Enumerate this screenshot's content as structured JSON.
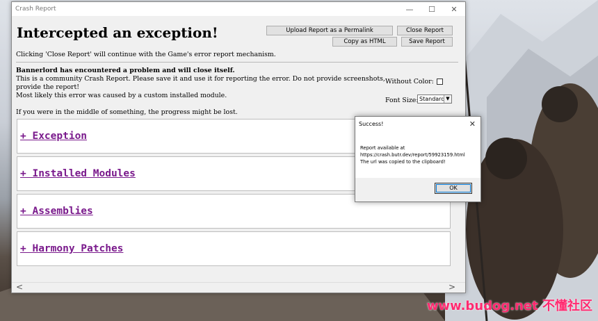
{
  "window": {
    "title": "Crash Report",
    "controls": {
      "minimize": "—",
      "maximize": "☐",
      "close": "✕"
    }
  },
  "header": {
    "heading": "Intercepted an exception!",
    "buttons": {
      "upload": "Upload Report as a Permalink",
      "close_report": "Close Report",
      "copy_html": "Copy as HTML",
      "save_report": "Save Report"
    },
    "note": "Clicking 'Close Report' will continue with the Game's error report mechanism."
  },
  "info": {
    "bold_line": "Bannerlord has encountered a problem and will close itself.",
    "line2": "This is a community Crash Report. Please save it and use it for reporting the error. Do not provide screenshots,",
    "line3": "provide the report!",
    "line4": "Most likely this error was caused by a custom installed module.",
    "line5": "If you were in the middle of something, the progress might be lost."
  },
  "options": {
    "without_color_label": "Without Color:",
    "font_size_label": "Font Size:",
    "font_size_value": "Standard"
  },
  "sections": [
    {
      "label": "+ Exception"
    },
    {
      "label": "+ Installed Modules"
    },
    {
      "label": "+ Assemblies"
    },
    {
      "label": "+ Harmony Patches"
    }
  ],
  "scrollbar": {
    "left": "<",
    "right": ">"
  },
  "dialog": {
    "title": "Success!",
    "line1": "Report available at",
    "line2": "https://crash.butr.dev/report/59923159.html",
    "line3": "The url was copied to the clipboard!",
    "ok": "OK"
  },
  "watermark": "www.budog.net 不懂社区"
}
